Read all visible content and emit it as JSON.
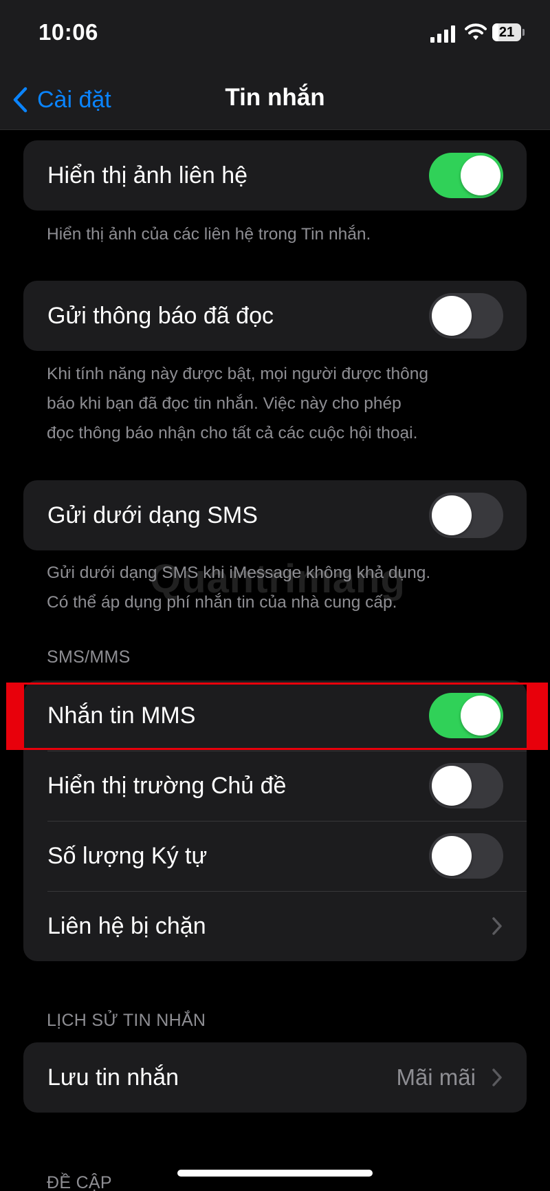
{
  "status_bar": {
    "time": "10:06",
    "battery_level": "21"
  },
  "nav": {
    "back_label": "Cài đặt",
    "title": "Tin nhắn"
  },
  "groups": {
    "contact_photos": {
      "label": "Hiển thị ảnh liên hệ",
      "on": true,
      "footnote": "Hiển thị ảnh của các liên hệ trong Tin nhắn."
    },
    "read_receipts": {
      "label": "Gửi thông báo đã đọc",
      "on": false,
      "footnote_lines": [
        "Khi tính năng này được bật, mọi người được thông",
        "báo khi bạn đã đọc tin nhắn. Việc này cho phép",
        "đọc thông báo nhận cho tất cả các cuộc hội thoại."
      ]
    },
    "send_as_sms": {
      "label": "Gửi dưới dạng SMS",
      "on": false,
      "footnote_lines": [
        "Gửi dưới dạng SMS khi iMessage không khả dụng.",
        "Có thể áp dụng phí nhắn tin của nhà cung cấp."
      ]
    },
    "sms_mms": {
      "header": "SMS/MMS",
      "items": [
        {
          "label": "Nhắn tin MMS",
          "type": "toggle",
          "on": true
        },
        {
          "label": "Hiển thị trường Chủ đề",
          "type": "toggle",
          "on": false
        },
        {
          "label": "Số lượng Ký tự",
          "type": "toggle",
          "on": false
        },
        {
          "label": "Liên hệ bị chặn",
          "type": "link"
        }
      ]
    },
    "message_history": {
      "header": "LỊCH SỬ TIN NHẮN",
      "label": "Lưu tin nhắn",
      "value": "Mãi mãi"
    },
    "mentions": {
      "header": "ĐỀ CẬP"
    }
  },
  "watermark": "Quantrimang",
  "colors": {
    "accent": "#0a84ff",
    "toggle_on": "#30d158",
    "highlight": "#e8000b"
  },
  "icons": [
    "chevron-left-icon",
    "cellular-signal-icon",
    "wifi-icon",
    "battery-icon",
    "chevron-right-icon"
  ]
}
